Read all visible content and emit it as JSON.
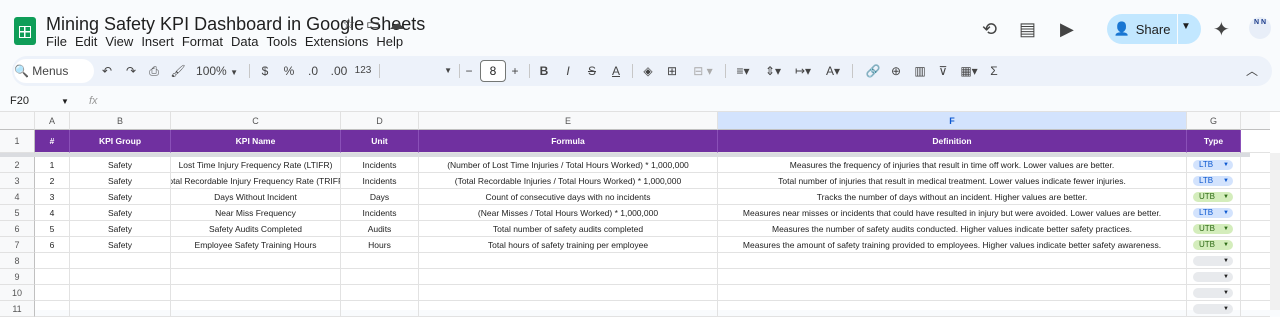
{
  "doc": {
    "title": "Mining Safety KPI Dashboard in Google Sheets"
  },
  "menu": [
    "File",
    "Edit",
    "View",
    "Insert",
    "Format",
    "Data",
    "Tools",
    "Extensions",
    "Help"
  ],
  "share": {
    "label": "Share"
  },
  "avatar": {
    "text": "N N"
  },
  "toolbar": {
    "menus": "Menus",
    "zoom": "100%",
    "currency": "$",
    "percent": "%",
    "dec_dec": ".0",
    "inc_dec": ".00",
    "number_format": "123",
    "font_size": "8",
    "minus": "−",
    "plus": "+",
    "bold": "B",
    "sigma": "Σ"
  },
  "formula_bar": {
    "cell_ref": "F20",
    "fx": "fx"
  },
  "columns": [
    "A",
    "B",
    "C",
    "D",
    "E",
    "F",
    "G"
  ],
  "header": [
    "#",
    "KPI Group",
    "KPI Name",
    "Unit",
    "Formula",
    "Definition",
    "Type"
  ],
  "rows": [
    {
      "n": "1",
      "group": "Safety",
      "name": "Lost Time Injury Frequency Rate (LTIFR)",
      "unit": "Incidents",
      "formula": "(Number of Lost Time Injuries / Total Hours Worked) * 1,000,000",
      "definition": "Measures the frequency of injuries that result in time off work. Lower values are better.",
      "type": "LTB"
    },
    {
      "n": "2",
      "group": "Safety",
      "name": "Total Recordable Injury Frequency Rate (TRIFR)",
      "unit": "Incidents",
      "formula": "(Total Recordable Injuries / Total Hours Worked) * 1,000,000",
      "definition": "Total number of injuries that result in medical treatment. Lower values indicate fewer injuries.",
      "type": "LTB"
    },
    {
      "n": "3",
      "group": "Safety",
      "name": "Days Without Incident",
      "unit": "Days",
      "formula": "Count of consecutive days with no incidents",
      "definition": "Tracks the number of days without an incident. Higher values are better.",
      "type": "UTB"
    },
    {
      "n": "4",
      "group": "Safety",
      "name": "Near Miss Frequency",
      "unit": "Incidents",
      "formula": "(Near Misses / Total Hours Worked) * 1,000,000",
      "definition": "Measures near misses or incidents that could have resulted in injury but were avoided. Lower values are better.",
      "type": "LTB"
    },
    {
      "n": "5",
      "group": "Safety",
      "name": "Safety Audits Completed",
      "unit": "Audits",
      "formula": "Total number of safety audits completed",
      "definition": "Measures the number of safety audits conducted. Higher values indicate better safety practices.",
      "type": "UTB"
    },
    {
      "n": "6",
      "group": "Safety",
      "name": "Employee Safety Training Hours",
      "unit": "Hours",
      "formula": "Total hours of safety training per employee",
      "definition": "Measures the amount of safety training provided to employees. Higher values indicate better safety awareness.",
      "type": "UTB"
    }
  ],
  "row_numbers": [
    "1",
    "2",
    "3",
    "4",
    "5",
    "6",
    "7",
    "8",
    "9",
    "10",
    "11"
  ],
  "colors": {
    "header_bg": "#7030a0",
    "ltb_chip": "#d3e3fd",
    "utb_chip": "#d4edbc",
    "share_bg": "#c2e7ff"
  }
}
